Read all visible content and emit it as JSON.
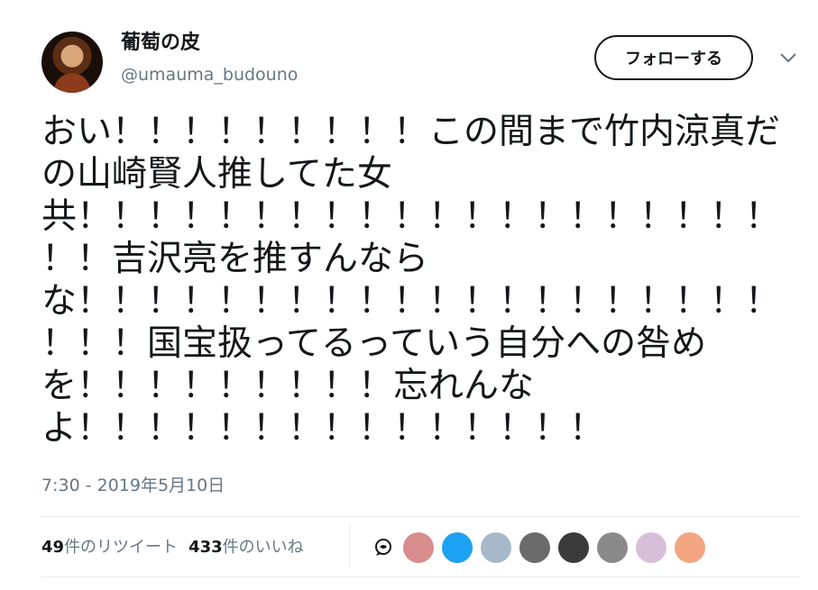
{
  "user": {
    "display_name": "葡萄の皮",
    "handle": "@umauma_budouno"
  },
  "follow_button": {
    "label": "フォローする"
  },
  "tweet": {
    "text": "おい！！！！！！！！！この間まで竹内涼真だの山崎賢人推してた女\n共！！！！！！！！！！！！！！！！！！！！\n！！吉沢亮を推すんなら\nな！！！！！！！！！！！！！！！！！！！！\n！！！国宝扱ってるっていう自分への咎め\nを！！！！！！！！！忘れんな\nよ！！！！！！！！！！！！！！！"
  },
  "timestamp": "7:30 - 2019年5月10日",
  "stats": {
    "retweets": {
      "count": "49",
      "label": "件のリツイート"
    },
    "likes": {
      "count": "433",
      "label": "件のいいね"
    }
  },
  "likers": [
    {
      "name": "liker-avatar-1",
      "color": "#d98c8c"
    },
    {
      "name": "liker-avatar-2",
      "color": "#1da1f2"
    },
    {
      "name": "liker-avatar-3",
      "color": "#a7b8c9"
    },
    {
      "name": "liker-avatar-4",
      "color": "#6b6b6b"
    },
    {
      "name": "liker-avatar-5",
      "color": "#3a3a3a"
    },
    {
      "name": "liker-avatar-6",
      "color": "#8a8a8a"
    },
    {
      "name": "liker-avatar-7",
      "color": "#d8bfd8"
    },
    {
      "name": "liker-avatar-8",
      "color": "#f4a582"
    }
  ],
  "colors": {
    "text": "#14171a",
    "secondary": "#657786",
    "divider": "#e6ecf0"
  }
}
